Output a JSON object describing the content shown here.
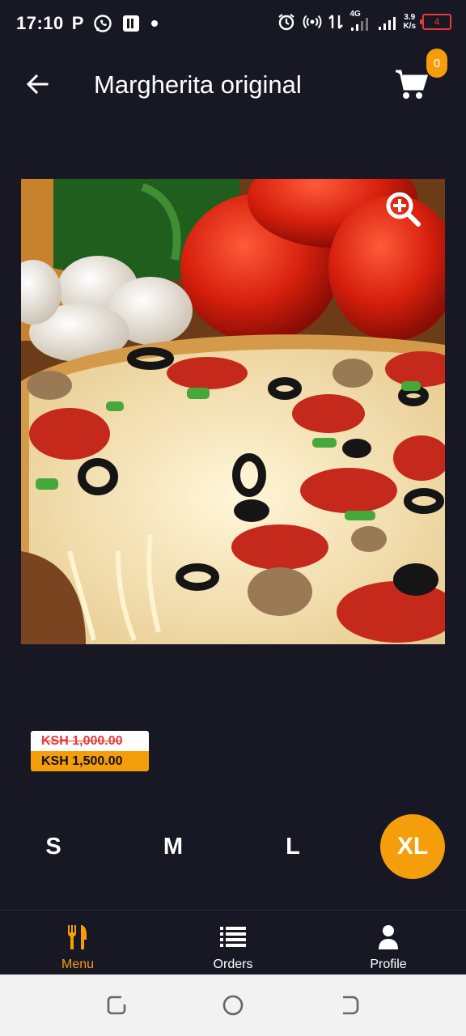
{
  "status_bar": {
    "time": "17:10",
    "left_icons": [
      "P",
      "whatsapp-icon",
      "parking-app-icon",
      "•"
    ],
    "network": "4G",
    "speed_top": "3.9",
    "speed_bottom": "K/s",
    "battery": "4"
  },
  "header": {
    "title": "Margherita original",
    "cart_count": "0"
  },
  "price": {
    "old": "KSH 1,000.00",
    "new": "KSH 1,500.00"
  },
  "sizes": {
    "s": "S",
    "m": "M",
    "l": "L",
    "xl": "XL",
    "selected": "XL"
  },
  "bottom_nav": {
    "menu": "Menu",
    "orders": "Orders",
    "profile": "Profile",
    "active": "Menu"
  },
  "colors": {
    "background": "#181825",
    "accent": "#f59e0b",
    "strike": "#e53935"
  }
}
